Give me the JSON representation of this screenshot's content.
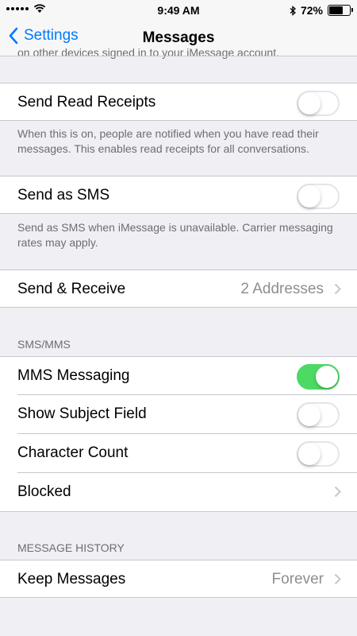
{
  "status_bar": {
    "time": "9:49 AM",
    "battery_percent": "72%",
    "battery_level": 0.72,
    "icons": [
      "signal-icon",
      "wifi-icon",
      "bluetooth-icon",
      "battery-icon"
    ]
  },
  "nav": {
    "back_label": "Settings",
    "title": "Messages"
  },
  "top_clipped_text": "on other devices signed in to your iMessage account.",
  "rows": {
    "read_receipts": {
      "label": "Send Read Receipts",
      "on": false
    },
    "read_receipts_footer": "When this is on, people are notified when you have read their messages. This enables read receipts for all conversations.",
    "send_as_sms": {
      "label": "Send as SMS",
      "on": false
    },
    "send_as_sms_footer": "Send as SMS when iMessage is unavailable. Carrier messaging rates may apply.",
    "send_receive": {
      "label": "Send & Receive",
      "value": "2 Addresses"
    }
  },
  "sms_mms": {
    "header": "SMS/MMS",
    "mms": {
      "label": "MMS Messaging",
      "on": true
    },
    "subject": {
      "label": "Show Subject Field",
      "on": false
    },
    "char_count": {
      "label": "Character Count",
      "on": false
    },
    "blocked": {
      "label": "Blocked"
    }
  },
  "history": {
    "header": "MESSAGE HISTORY",
    "keep": {
      "label": "Keep Messages",
      "value": "Forever"
    }
  },
  "colors": {
    "accent": "#007aff",
    "toggle_on": "#4cd964",
    "background": "#efeff4"
  }
}
